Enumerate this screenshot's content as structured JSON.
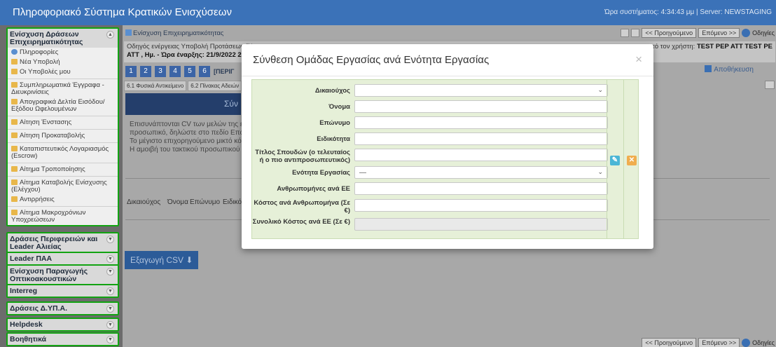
{
  "app": {
    "title": "Πληροφοριακό Σύστημα Κρατικών Ενισχύσεων",
    "status": "Ώρα συστήματος: 4:34:43 μμ | Server: NEWSTAGING"
  },
  "sidebar": {
    "sections": [
      {
        "title": "Ενίσχυση Δράσεων Επιχειρηματικότητας",
        "items": [
          "Πληροφορίες",
          "Νέα Υποβολή",
          "Οι Υποβολές μου",
          "Συμπληρωματικά Έγγραφα - Διευκρινίσεις",
          "Απογραφικά Δελτία Εισόδου/Εξόδου Ωφελουμένων",
          "Αίτηση Ένστασης",
          "Αίτηση Προκαταβολής",
          "Καταπιστευτικός Λογαριασμός (Escrow)",
          "Αίτημα Τροποποίησης",
          "Αίτημα Καταβολής Ενίσχυσης (Ελέγχου)",
          "Αντιρρήσεις",
          "Αίτημα Μακροχρόνιων Υποχρεώσεων"
        ]
      },
      {
        "title": "Δράσεις Περιφερειών και Leader Αλιείας"
      },
      {
        "title": "Leader ΠΑΑ"
      },
      {
        "title": "Ενίσχυση Παραγωγής Οπτικοακουστικών Έργων"
      },
      {
        "title": "Interreg"
      },
      {
        "title": "Δράσεις Δ.ΥΠ.Α."
      },
      {
        "title": "Helpdesk"
      },
      {
        "title": "Βοηθητικά"
      }
    ]
  },
  "main": {
    "breadcrumb": "Ενίσχυση Επιχειρηματικότητας",
    "info_line1": "Οδηγός ενέργειας Υποβολή Προτάσεων [Να",
    "info_line2_prefix": "ATT , Ηµ. - Ώρα έναρξης:",
    "info_line2_date": "21/9/2022 2:",
    "info_right_prefix": "από τον χρήστη:",
    "info_right_user": "TEST PEP ATT TEST PE",
    "steps": [
      "1",
      "2",
      "3",
      "4",
      "5",
      "6"
    ],
    "step_tag": "[ΠΕΡΙΓ",
    "subtabs": [
      "6.1 Φυσικά Αντικείμενο",
      "6.2 Πίνακας Αδειών"
    ],
    "band_text": "Σύν",
    "body_lines": [
      "Επισυνάπτονται CV των μελών της ερευνη",
      "προσωπικό, δηλώστε στο πεδίο Επώνυμο",
      "Το μέγιστο επιχορηγούμενο μικτό κόστος ο",
      "Η αμοιβή του τακτικού προσωπικού του δι"
    ],
    "columns": [
      "Δικαιούχος",
      "Όνομα",
      "Επώνυμο",
      "Ειδικότ"
    ],
    "csv_button": "Εξαγωγή CSV ⬇",
    "save_label": "Αποθήκευση",
    "nav": {
      "prev": "<< Προηγούμενο",
      "next": "Επόμενο >>",
      "help": "Οδηγίες"
    }
  },
  "modal": {
    "title": "Σύνθεση Ομάδας Εργασίας ανά Ενότητα Εργασίας",
    "close": "×",
    "fields": [
      {
        "label": "Δικαιούχος",
        "type": "select",
        "value": ""
      },
      {
        "label": "Όνομα",
        "type": "text",
        "value": ""
      },
      {
        "label": "Επώνυμο",
        "type": "text",
        "value": ""
      },
      {
        "label": "Ειδικότητα",
        "type": "text",
        "value": ""
      },
      {
        "label": "Τίτλος Σπουδών (ο τελευταίος ή ο πιο αντιπροσωπευτικός)",
        "type": "text",
        "value": ""
      },
      {
        "label": "Ενότητα Εργασίας",
        "type": "select",
        "value": "—"
      },
      {
        "label": "Ανθρωπομήνες ανά ΕΕ",
        "type": "text",
        "value": ""
      },
      {
        "label": "Κόστος ανά Ανθρωπομήνα (Σε €)",
        "type": "text",
        "value": ""
      },
      {
        "label": "Συνολικό Κόστος ανά ΕΕ (Σε €)",
        "type": "readonly",
        "value": ""
      }
    ],
    "actions": {
      "edit_glyph": "✎",
      "cancel_glyph": "✕"
    },
    "colors": {
      "edit": "#4bb6d6",
      "cancel": "#f0ad4e"
    }
  }
}
